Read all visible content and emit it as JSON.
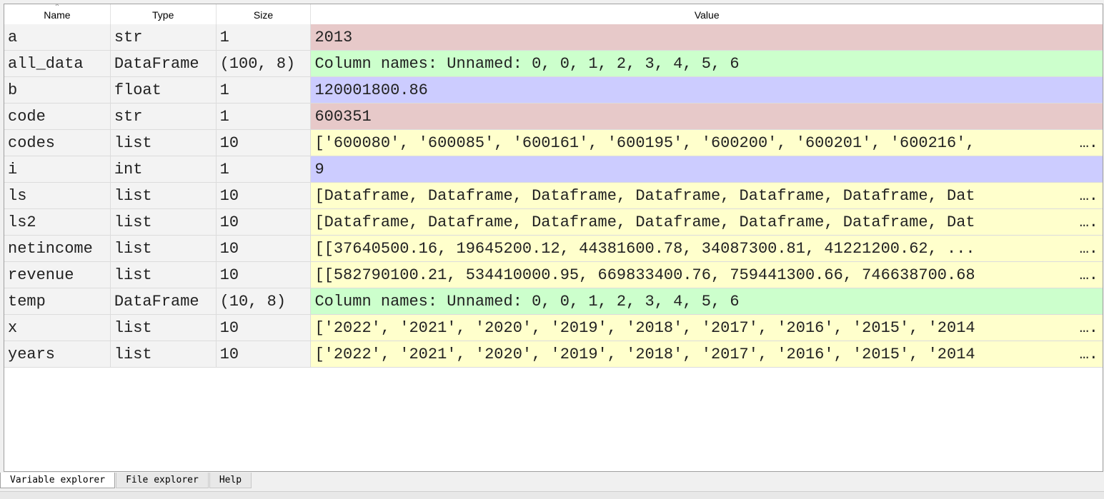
{
  "columns": {
    "name": "Name",
    "type": "Type",
    "size": "Size",
    "value": "Value"
  },
  "sort_indicator": "^",
  "rows": [
    {
      "name": "a",
      "type": "str",
      "size": "1",
      "value": "2013",
      "kind": "str",
      "truncated": false
    },
    {
      "name": "all_data",
      "type": "DataFrame",
      "size": "(100, 8)",
      "value": "Column names: Unnamed: 0, 0, 1, 2, 3, 4, 5, 6",
      "kind": "df",
      "truncated": false
    },
    {
      "name": "b",
      "type": "float",
      "size": "1",
      "value": "120001800.86",
      "kind": "num",
      "truncated": false
    },
    {
      "name": "code",
      "type": "str",
      "size": "1",
      "value": "600351",
      "kind": "str",
      "truncated": false
    },
    {
      "name": "codes",
      "type": "list",
      "size": "10",
      "value": "['600080', '600085', '600161', '600195', '600200', '600201', '600216',",
      "kind": "list",
      "truncated": true
    },
    {
      "name": "i",
      "type": "int",
      "size": "1",
      "value": "9",
      "kind": "num",
      "truncated": false
    },
    {
      "name": "ls",
      "type": "list",
      "size": "10",
      "value": "[Dataframe, Dataframe, Dataframe, Dataframe, Dataframe, Dataframe, Dat",
      "kind": "list",
      "truncated": true
    },
    {
      "name": "ls2",
      "type": "list",
      "size": "10",
      "value": "[Dataframe, Dataframe, Dataframe, Dataframe, Dataframe, Dataframe, Dat",
      "kind": "list",
      "truncated": true
    },
    {
      "name": "netincome",
      "type": "list",
      "size": "10",
      "value": "[[37640500.16, 19645200.12, 44381600.78, 34087300.81, 41221200.62, ...",
      "kind": "list",
      "truncated": true
    },
    {
      "name": "revenue",
      "type": "list",
      "size": "10",
      "value": "[[582790100.21, 534410000.95, 669833400.76, 759441300.66, 746638700.68",
      "kind": "list",
      "truncated": true
    },
    {
      "name": "temp",
      "type": "DataFrame",
      "size": "(10, 8)",
      "value": "Column names: Unnamed: 0, 0, 1, 2, 3, 4, 5, 6",
      "kind": "df",
      "truncated": false
    },
    {
      "name": "x",
      "type": "list",
      "size": "10",
      "value": "['2022', '2021', '2020', '2019', '2018', '2017', '2016', '2015', '2014",
      "kind": "list",
      "truncated": true
    },
    {
      "name": "years",
      "type": "list",
      "size": "10",
      "value": "['2022', '2021', '2020', '2019', '2018', '2017', '2016', '2015', '2014",
      "kind": "list",
      "truncated": true
    }
  ],
  "ellipsis": "….",
  "tabs": [
    {
      "label": "Variable explorer",
      "active": true
    },
    {
      "label": "File explorer",
      "active": false
    },
    {
      "label": "Help",
      "active": false
    }
  ],
  "colors": {
    "str": "#e7c9c9",
    "dataframe": "#ccffcc",
    "numeric": "#ccccff",
    "list": "#ffffcc"
  }
}
